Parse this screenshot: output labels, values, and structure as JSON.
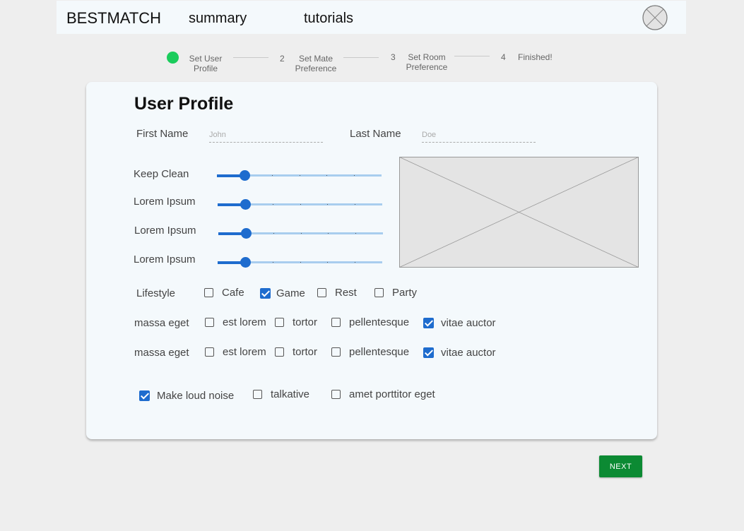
{
  "header": {
    "brand": "BESTMATCH",
    "nav": [
      "summary",
      "tutorials"
    ],
    "avatar_icon": "avatar-placeholder-icon"
  },
  "stepper": {
    "active_color": "#1bcc5c",
    "steps": [
      {
        "number": "1",
        "label": "Set User Profile",
        "active": true
      },
      {
        "number": "2",
        "label": "Set Mate Preference",
        "active": false
      },
      {
        "number": "3",
        "label": "Set Room Preference",
        "active": false
      },
      {
        "number": "4",
        "label": "Finished!",
        "active": false
      }
    ]
  },
  "form": {
    "title": "User Profile",
    "first_name": {
      "label": "First Name",
      "placeholder": "John"
    },
    "last_name": {
      "label": "Last Name",
      "placeholder": "Doe"
    },
    "sliders": [
      {
        "label": "Keep Clean",
        "value": 1,
        "max": 6
      },
      {
        "label": "Lorem Ipsum",
        "value": 1,
        "max": 6
      },
      {
        "label": "Lorem Ipsum",
        "value": 1,
        "max": 6
      },
      {
        "label": "Lorem Ipsum",
        "value": 1,
        "max": 6
      }
    ],
    "image_placeholder_icon": "image-placeholder-icon",
    "lifestyle": {
      "label": "Lifestyle",
      "options": [
        {
          "label": "Cafe",
          "checked": false
        },
        {
          "label": "Game",
          "checked": true
        },
        {
          "label": "Rest",
          "checked": false
        },
        {
          "label": "Party",
          "checked": false
        }
      ]
    },
    "massa_rows": [
      {
        "label": "massa eget",
        "options": [
          {
            "label": "est lorem",
            "checked": false
          },
          {
            "label": "tortor",
            "checked": false
          },
          {
            "label": "pellentesque",
            "checked": false
          },
          {
            "label": "vitae auctor",
            "checked": true
          }
        ]
      },
      {
        "label": "massa eget",
        "options": [
          {
            "label": "est lorem",
            "checked": false
          },
          {
            "label": "tortor",
            "checked": false
          },
          {
            "label": "pellentesque",
            "checked": false
          },
          {
            "label": "vitae auctor",
            "checked": true
          }
        ]
      }
    ],
    "traits": [
      {
        "label": "Make loud noise",
        "checked": true
      },
      {
        "label": "talkative",
        "checked": false
      },
      {
        "label": "amet porttitor eget",
        "checked": false
      }
    ]
  },
  "actions": {
    "next_label": "NEXT",
    "next_color": "#0c8a33"
  },
  "colors": {
    "accent": "#1e6cce",
    "slider_track": "#a8cdee",
    "card_bg": "#f4f9fc",
    "page_bg": "#eeeeee"
  }
}
